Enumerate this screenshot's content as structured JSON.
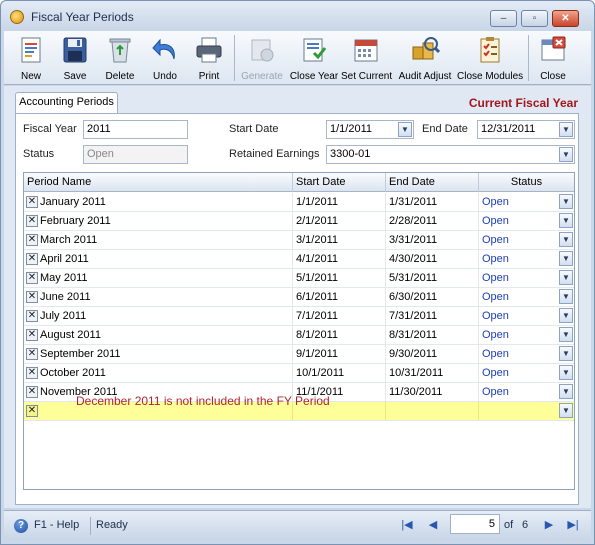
{
  "window": {
    "title": "Fiscal Year Periods"
  },
  "toolbar": {
    "buttons": [
      {
        "label": "New",
        "icon": "new-document-icon"
      },
      {
        "label": "Save",
        "icon": "floppy-disk-icon"
      },
      {
        "label": "Delete",
        "icon": "recycle-bin-icon"
      },
      {
        "label": "Undo",
        "icon": "undo-arrow-icon"
      },
      {
        "label": "Print",
        "icon": "printer-icon"
      },
      {
        "label": "Generate",
        "icon": "generate-icon",
        "disabled": true
      },
      {
        "label": "Close Year",
        "icon": "close-year-icon"
      },
      {
        "label": "Set Current",
        "icon": "calendar-icon"
      },
      {
        "label": "Audit Adjust",
        "icon": "audit-adjust-icon"
      },
      {
        "label": "Close Modules",
        "icon": "checklist-icon"
      },
      {
        "label": "Close",
        "icon": "close-window-icon"
      }
    ]
  },
  "tab": {
    "label": "Accounting Periods"
  },
  "current_fiscal_year_label": "Current Fiscal Year",
  "form": {
    "fiscal_year_label": "Fiscal Year",
    "fiscal_year_value": "2011",
    "status_label": "Status",
    "status_value": "Open",
    "start_date_label": "Start Date",
    "start_date_value": "1/1/2011",
    "end_date_label": "End Date",
    "end_date_value": "12/31/2011",
    "retained_earnings_label": "Retained Earnings",
    "retained_earnings_value": "3300-01"
  },
  "grid": {
    "columns": [
      "Period Name",
      "Start Date",
      "End Date",
      "Status"
    ],
    "rows": [
      {
        "name": "January 2011",
        "start": "1/1/2011",
        "end": "1/31/2011",
        "status": "Open"
      },
      {
        "name": "February 2011",
        "start": "2/1/2011",
        "end": "2/28/2011",
        "status": "Open"
      },
      {
        "name": "March 2011",
        "start": "3/1/2011",
        "end": "3/31/2011",
        "status": "Open"
      },
      {
        "name": "April 2011",
        "start": "4/1/2011",
        "end": "4/30/2011",
        "status": "Open"
      },
      {
        "name": "May 2011",
        "start": "5/1/2011",
        "end": "5/31/2011",
        "status": "Open"
      },
      {
        "name": "June 2011",
        "start": "6/1/2011",
        "end": "6/30/2011",
        "status": "Open"
      },
      {
        "name": "July 2011",
        "start": "7/1/2011",
        "end": "7/31/2011",
        "status": "Open"
      },
      {
        "name": "August 2011",
        "start": "8/1/2011",
        "end": "8/31/2011",
        "status": "Open"
      },
      {
        "name": "September 2011",
        "start": "9/1/2011",
        "end": "9/30/2011",
        "status": "Open"
      },
      {
        "name": "October 2011",
        "start": "10/1/2011",
        "end": "10/31/2011",
        "status": "Open"
      },
      {
        "name": "November 2011",
        "start": "11/1/2011",
        "end": "11/30/2011",
        "status": "Open"
      }
    ]
  },
  "note": "December 2011 is not included in the FY Period",
  "statusbar": {
    "help": "F1 - Help",
    "state": "Ready",
    "page_current": "5",
    "page_of": "of",
    "page_total": "6"
  },
  "colors": {
    "accent_red": "#a3161c",
    "status_blue": "#1d3fb5",
    "new_row_yellow": "#ffff99"
  }
}
